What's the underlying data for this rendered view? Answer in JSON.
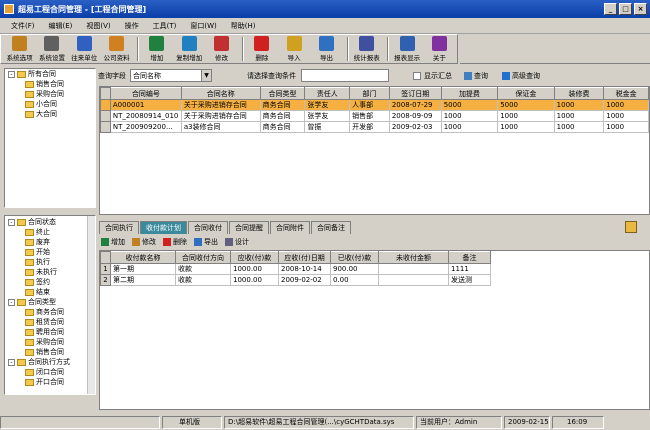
{
  "window": {
    "title": "超易工程合同管理 - [工程合同管理]",
    "min": "_",
    "max": "□",
    "close": "×"
  },
  "menu": [
    "文件(F)",
    "编辑(E)",
    "视图(V)",
    "操作",
    "工具(T)",
    "窗口(W)",
    "帮助(H)"
  ],
  "toolbar": [
    {
      "label": "系统选项",
      "color": "#c08020"
    },
    {
      "label": "系统设置",
      "color": "#606060"
    },
    {
      "label": "往来单位",
      "color": "#3060c0"
    },
    {
      "label": "公司资料",
      "color": "#d08020"
    },
    {
      "label": "增加",
      "color": "#208040"
    },
    {
      "label": "复制增加",
      "color": "#2080c0"
    },
    {
      "label": "修改",
      "color": "#c03030"
    },
    {
      "label": "删除",
      "color": "#d02020"
    },
    {
      "label": "导入",
      "color": "#d0a020"
    },
    {
      "label": "导出",
      "color": "#3070c0"
    },
    {
      "label": "统计报表",
      "color": "#4050a0"
    },
    {
      "label": "报表显示",
      "color": "#3060b0"
    },
    {
      "label": "关于",
      "color": "#8030a0"
    }
  ],
  "tree_top": {
    "root": "所有合同",
    "children": [
      "销售合同",
      "采购合同",
      "小合同",
      "大合同"
    ]
  },
  "tree_bottom": [
    {
      "label": "合同状态",
      "expander": "-",
      "children": [
        "终止",
        "废弃",
        "开始",
        "执行",
        "未执行",
        "签约",
        "结束"
      ]
    },
    {
      "label": "合同类型",
      "expander": "-",
      "children": [
        "商务合同",
        "租赁合同",
        "聘用合同",
        "采购合同",
        "销售合同"
      ]
    },
    {
      "label": "合同执行方式",
      "expander": "-",
      "children": [
        "闭口合同",
        "开口合同"
      ]
    }
  ],
  "query": {
    "field_label": "查询字段",
    "field_value": "合同名称",
    "cond_label": "请选择查询条件",
    "cond_value": "",
    "show_summary": "显示汇总",
    "search": "查询",
    "advanced": "高级查询"
  },
  "main_grid": {
    "columns": [
      "合同编号",
      "合同名称",
      "合同类型",
      "责任人",
      "部门",
      "签订日期",
      "加提费",
      "保证金",
      "装修费",
      "税金金"
    ],
    "rows": [
      [
        "A000001",
        "关于采购进销存合同",
        "商务合同",
        "张学友",
        "人事部",
        "2008-07-29",
        "5000",
        "5000",
        "1000",
        "1000"
      ],
      [
        "NT_20080914_010",
        "关于采购进销存合同",
        "商务合同",
        "张学友",
        "销售部",
        "2008-09-09",
        "1000",
        "1000",
        "1000",
        "1000"
      ],
      [
        "NT_200909200...",
        "a3装修合同",
        "商务合同",
        "曾振",
        "开发部",
        "2009-02-03",
        "1000",
        "1000",
        "1000",
        "1000"
      ]
    ]
  },
  "tabs": [
    "合同执行",
    "收付款计划",
    "合同收付",
    "合同提醒",
    "合同附件",
    "合同备注"
  ],
  "active_tab": 1,
  "sub_toolbar": [
    "增加",
    "修改",
    "删除",
    "导出",
    "设计"
  ],
  "sub_grid": {
    "columns": [
      "收付款名称",
      "合同收付方向",
      "应收(付)款",
      "应收(付)日期",
      "已收(付)款",
      "未收付金额",
      "备注"
    ],
    "rows": [
      [
        "1",
        "第一期",
        "收款",
        "1000.00",
        "2008-10-14",
        "900.00",
        "",
        "1111"
      ],
      [
        "2",
        "第二期",
        "收款",
        "1000.00",
        "2009-02-02",
        "0.00",
        "",
        "发送测"
      ]
    ]
  },
  "status": {
    "single": "单机版",
    "path": "D:\\超易软件\\超易工程合同管理(...\\cyGCHTData.sys",
    "user": "当前用户：Admin",
    "date": "2009-02-15",
    "time": "16:09"
  },
  "colors": {
    "title": "#0a3fa8",
    "selected_row": "#f5b041",
    "active_tab": "#3a8a9c"
  }
}
